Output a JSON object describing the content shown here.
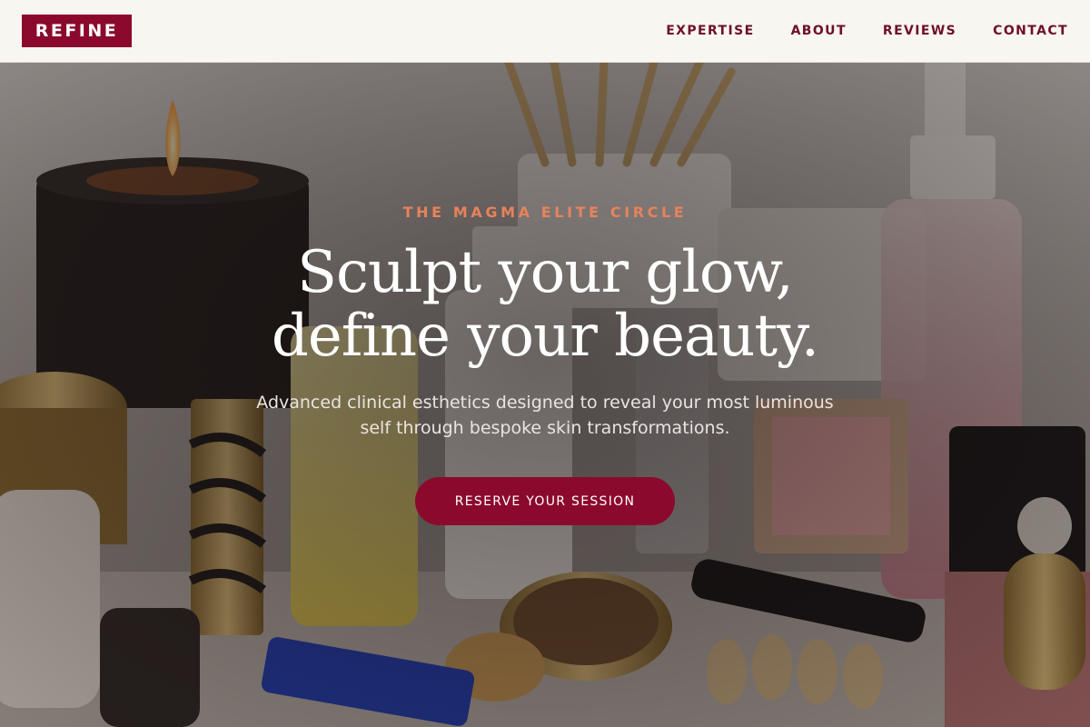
{
  "header": {
    "logo_text": "REFINE",
    "nav": [
      {
        "label": "EXPERTISE"
      },
      {
        "label": "ABOUT"
      },
      {
        "label": "REVIEWS"
      },
      {
        "label": "CONTACT"
      }
    ]
  },
  "hero": {
    "eyebrow": "THE MAGMA ELITE CIRCLE",
    "headline_line1": "Sculpt your glow,",
    "headline_line2": "define your beauty.",
    "subtext_line1": "Advanced clinical esthetics designed to reveal your most luminous",
    "subtext_line2": "self through bespoke skin transformations.",
    "cta_label": "RESERVE YOUR SESSION"
  },
  "colors": {
    "brand": "#8b0a2c",
    "nav_text": "#6e0f2a",
    "eyebrow": "#e8825c",
    "header_bg": "#f8f6f1"
  }
}
